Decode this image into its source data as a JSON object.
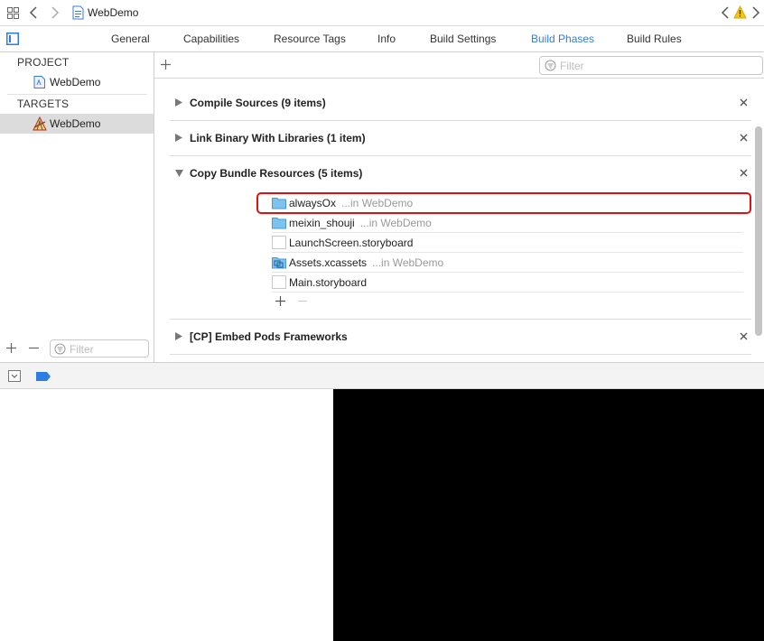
{
  "topbar": {
    "breadcrumb": "WebDemo"
  },
  "tabs": [
    {
      "label": "General",
      "active": false
    },
    {
      "label": "Capabilities",
      "active": false
    },
    {
      "label": "Resource Tags",
      "active": false
    },
    {
      "label": "Info",
      "active": false
    },
    {
      "label": "Build Settings",
      "active": false
    },
    {
      "label": "Build Phases",
      "active": true
    },
    {
      "label": "Build Rules",
      "active": false
    }
  ],
  "sidebar": {
    "project_header": "PROJECT",
    "project_item": "WebDemo",
    "targets_header": "TARGETS",
    "target_item": "WebDemo",
    "filter_placeholder": "Filter"
  },
  "main": {
    "filter_placeholder": "Filter",
    "phases": [
      {
        "title": "Compile Sources (9 items)",
        "expanded": false
      },
      {
        "title": "Link Binary With Libraries (1 item)",
        "expanded": false
      },
      {
        "title": "Copy Bundle Resources (5 items)",
        "expanded": true
      },
      {
        "title": "[CP] Embed Pods Frameworks",
        "expanded": false
      }
    ],
    "resources": [
      {
        "name": "alwaysOx",
        "location": "...in WebDemo",
        "icon": "folder-icon"
      },
      {
        "name": "meixin_shouji",
        "location": "...in WebDemo",
        "icon": "folder-icon"
      },
      {
        "name": "LaunchScreen.storyboard",
        "location": "",
        "icon": "file-icon"
      },
      {
        "name": "Assets.xcassets",
        "location": "...in WebDemo",
        "icon": "asset-catalog-icon"
      },
      {
        "name": "Main.storyboard",
        "location": "",
        "icon": "file-icon"
      }
    ]
  },
  "colors": {
    "accent": "#2d7de3",
    "highlight": "#e01010",
    "console_bg": "#000000"
  }
}
